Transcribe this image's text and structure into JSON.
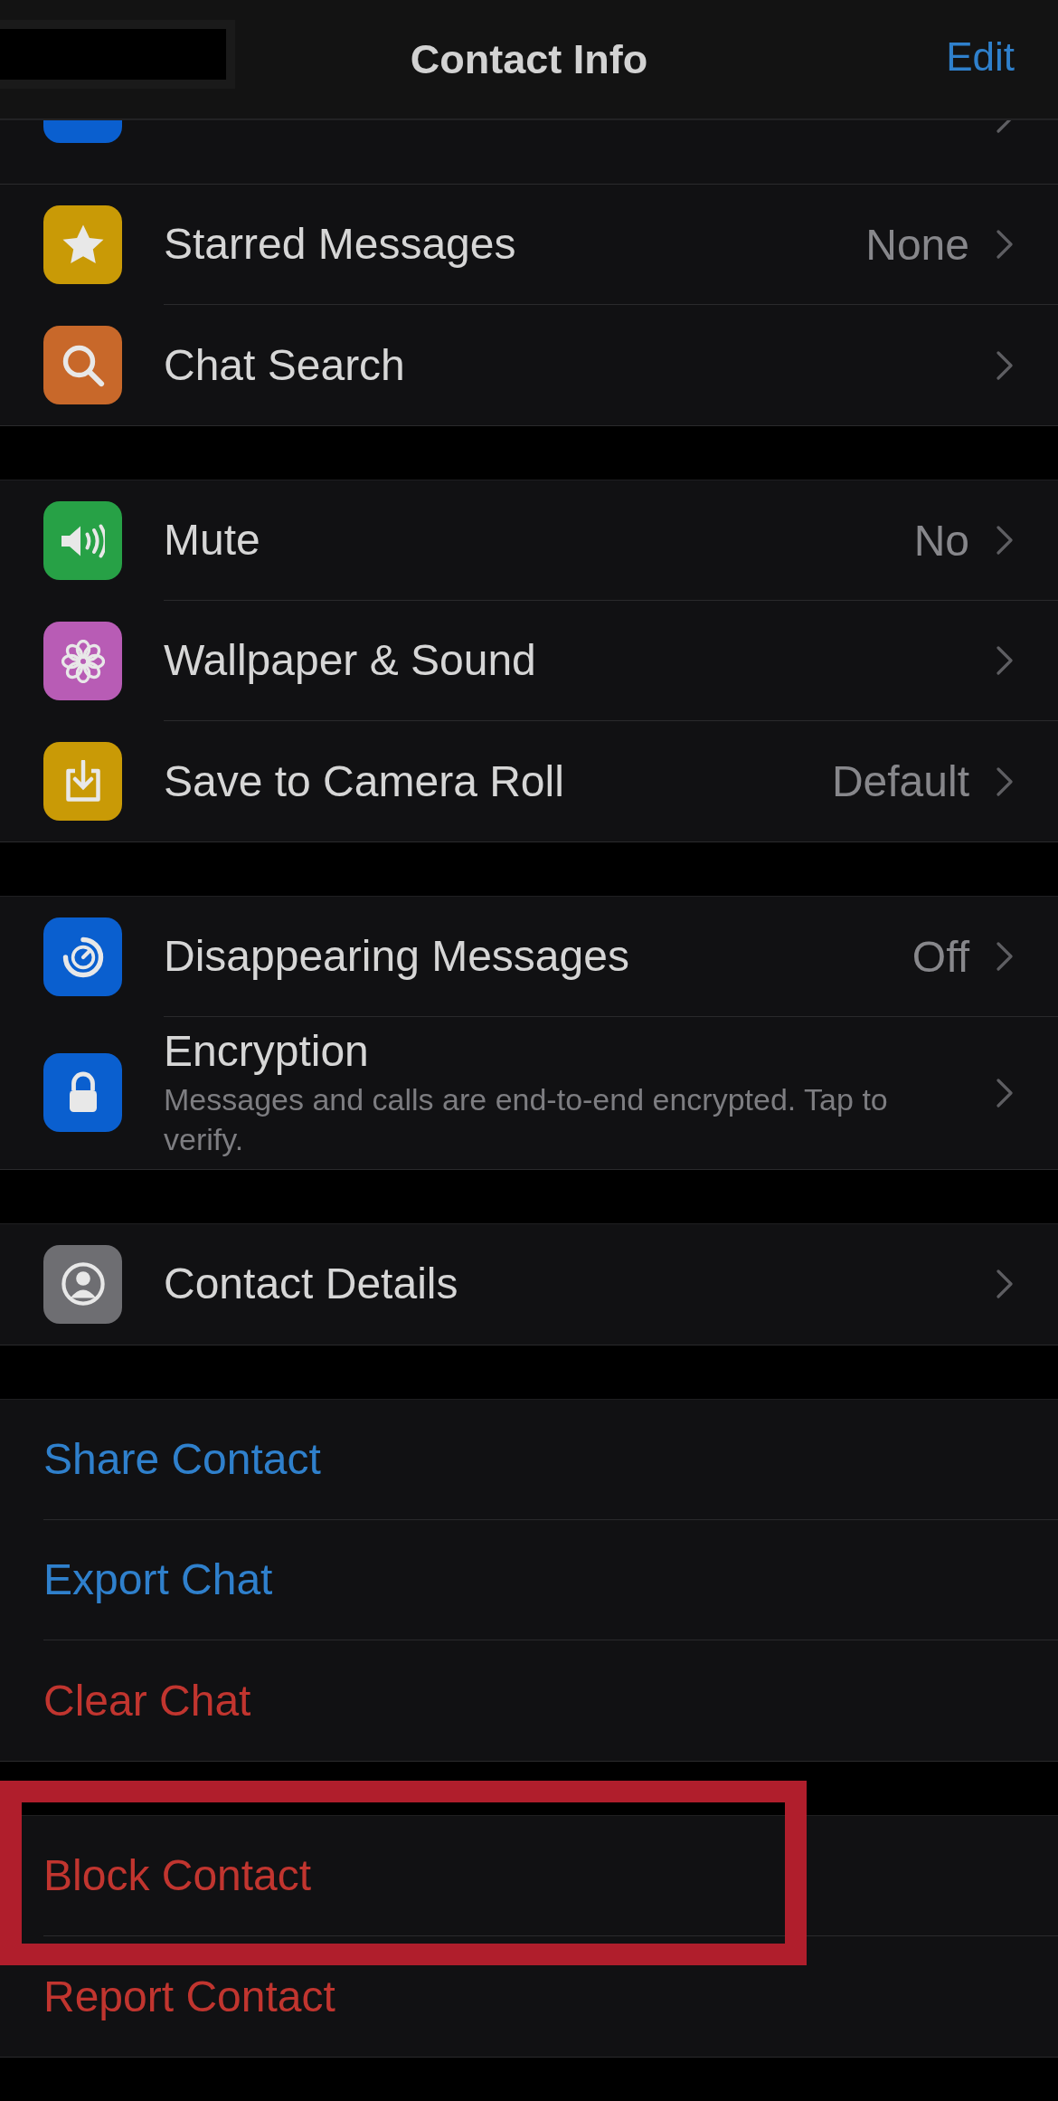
{
  "header": {
    "title": "Contact Info",
    "action": "Edit"
  },
  "groups": [
    {
      "rows": [
        {
          "kind": "clipped",
          "color": "#0a5fcf"
        },
        {
          "kind": "nav",
          "color": "#c99a06",
          "label": "Starred Messages",
          "value": "None"
        },
        {
          "kind": "nav",
          "color": "#c8682a",
          "label": "Chat Search"
        }
      ]
    },
    {
      "rows": [
        {
          "kind": "nav",
          "color": "#27a146",
          "label": "Mute",
          "value": "No"
        },
        {
          "kind": "nav",
          "color": "#b85cb5",
          "label": "Wallpaper & Sound"
        },
        {
          "kind": "nav",
          "color": "#c99a06",
          "label": "Save to Camera Roll",
          "value": "Default"
        }
      ]
    },
    {
      "rows": [
        {
          "kind": "nav",
          "color": "#0a5fcf",
          "label": "Disappearing Messages",
          "value": "Off"
        },
        {
          "kind": "nav",
          "color": "#0a5fcf",
          "label": "Encryption",
          "subtitle": "Messages and calls are end-to-end encrypted. Tap to verify."
        }
      ]
    },
    {
      "rows": [
        {
          "kind": "nav",
          "color": "#6e6e72",
          "label": "Contact Details"
        }
      ]
    },
    {
      "rows": [
        {
          "kind": "action",
          "destructive": false,
          "label": "Share Contact"
        },
        {
          "kind": "action",
          "destructive": false,
          "label": "Export Chat"
        },
        {
          "kind": "action",
          "destructive": true,
          "label": "Clear Chat"
        }
      ]
    },
    {
      "rows": [
        {
          "kind": "action",
          "destructive": true,
          "highlighted": true,
          "label": "Block Contact"
        },
        {
          "kind": "action",
          "destructive": true,
          "highlighted": false,
          "label": "Report Contact"
        }
      ]
    }
  ]
}
